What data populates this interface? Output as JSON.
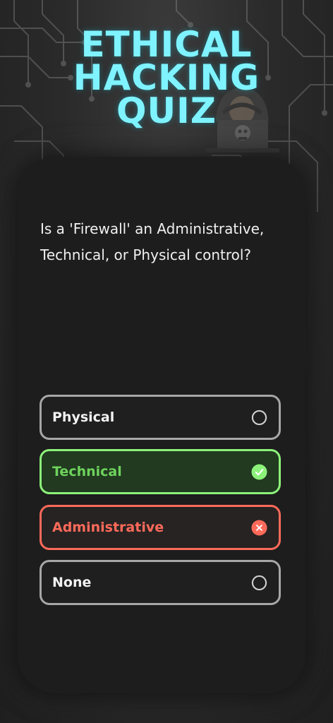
{
  "header": {
    "title_lines": [
      "ETHICAL",
      "HACKING",
      "QUIZ"
    ]
  },
  "quiz": {
    "question": "Is a 'Firewall' an Administrative, Technical, or Physical control?",
    "options": [
      {
        "label": "Physical",
        "state": "unselected",
        "icon": "radio-empty-icon"
      },
      {
        "label": "Technical",
        "state": "correct",
        "icon": "check-circle-icon"
      },
      {
        "label": "Administrative",
        "state": "incorrect",
        "icon": "x-circle-icon"
      },
      {
        "label": "None",
        "state": "unselected",
        "icon": "radio-empty-icon"
      }
    ]
  },
  "colors": {
    "title": "#7ff3ff",
    "correct": "#8cf27a",
    "incorrect": "#ff6a5a",
    "neutral_border": "#a7a7a7",
    "card_bg": "#1d1d1d"
  }
}
